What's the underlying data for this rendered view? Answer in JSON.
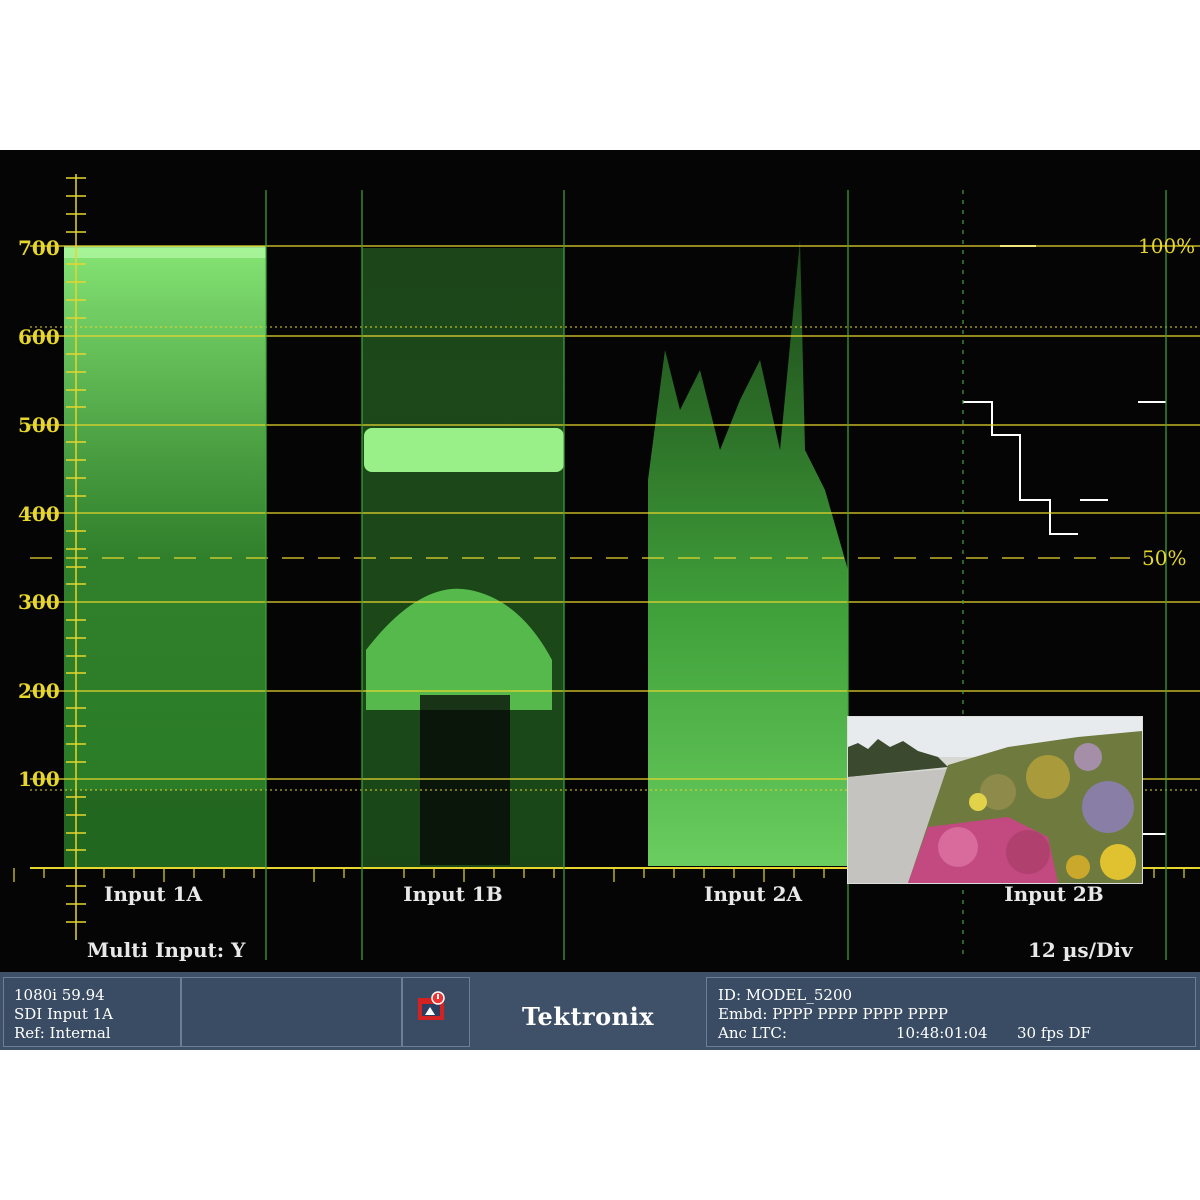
{
  "waveform": {
    "y_scale_labels": [
      "700",
      "600",
      "500",
      "400",
      "300",
      "200",
      "100"
    ],
    "percent_labels": [
      "100%",
      "50%"
    ],
    "inputs": [
      "Input 1A",
      "Input 1B",
      "Input 2A",
      "Input 2B"
    ],
    "mode_label": "Multi Input: Y",
    "timebase_label": "12 µs/Div",
    "colors": {
      "graticule": "#e6d62e",
      "trace": "#5fe05a",
      "text": "#e8e8e8"
    }
  },
  "status": {
    "format": "1080i 59.94",
    "input": "SDI Input 1A",
    "reference": "Ref: Internal",
    "alarm_icon": "alarm-icon",
    "brand": "Tektronix",
    "id": "ID: MODEL_5200",
    "embedded": "Embd: PPPP PPPP PPPP PPPP",
    "anc_label": "Anc LTC:",
    "timecode": "10:48:01:04",
    "frame_rate": "30 fps DF"
  }
}
